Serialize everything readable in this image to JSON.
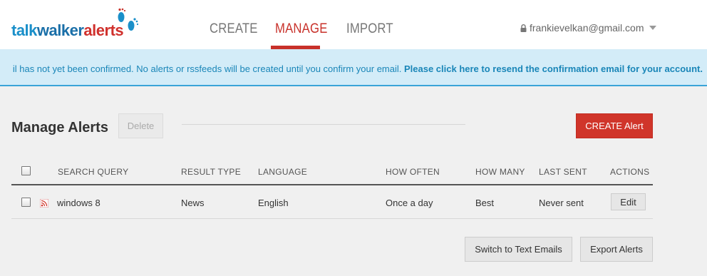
{
  "logo": {
    "part1": "talk",
    "part2": "walker",
    "part3": "alerts"
  },
  "nav": {
    "items": [
      {
        "label": "CREATE"
      },
      {
        "label": "MANAGE"
      },
      {
        "label": "IMPORT"
      }
    ]
  },
  "user": {
    "email": "frankievelkan@gmail.com"
  },
  "banner": {
    "message": "il has not yet been confirmed. No alerts or rssfeeds will be created until you confirm your email. ",
    "link": "Please click here to resend the confirmation email for your account."
  },
  "manage": {
    "title": "Manage Alerts",
    "delete_label": "Delete",
    "create_label": "CREATE Alert"
  },
  "table": {
    "columns": [
      "SEARCH QUERY",
      "RESULT TYPE",
      "LANGUAGE",
      "HOW OFTEN",
      "HOW MANY",
      "LAST SENT",
      "ACTIONS"
    ],
    "rows": [
      {
        "query": "windows 8",
        "result_type": "News",
        "language": "English",
        "how_often": "Once a day",
        "how_many": "Best",
        "last_sent": "Never sent",
        "action": "Edit"
      }
    ]
  },
  "footer": {
    "switch_label": "Switch to Text Emails",
    "export_label": "Export Alerts"
  },
  "colors": {
    "accent": "#c8312a",
    "banner_bg": "#d3ecf8",
    "banner_text": "#1a86b8"
  }
}
